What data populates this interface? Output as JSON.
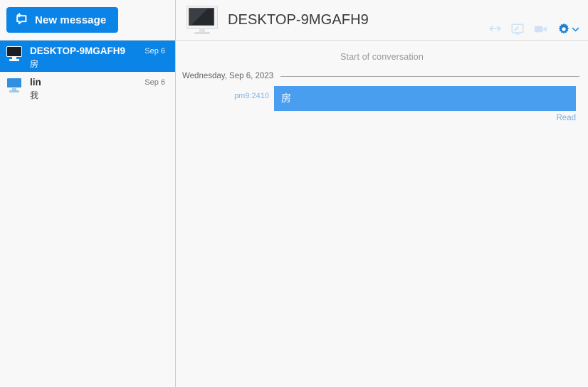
{
  "sidebar": {
    "new_message_button": {
      "label": "New message",
      "icon": "new-message-bubble-icon"
    },
    "conversations": [
      {
        "name": "DESKTOP-9MGAFH9",
        "preview": "房",
        "date": "Sep 6",
        "avatar_icon": "monitor-dark-icon",
        "selected": true
      },
      {
        "name": "lin",
        "preview": "我",
        "date": "Sep 6",
        "avatar_icon": "monitor-blue-icon",
        "selected": false
      }
    ]
  },
  "header": {
    "title": "DESKTOP-9MGAFH9",
    "avatar_icon": "monitor-icon",
    "actions": [
      {
        "name": "transfer-files-icon",
        "icon": "left-right-arrow-icon"
      },
      {
        "name": "remote-desktop-icon",
        "icon": "monitor-pen-icon"
      },
      {
        "name": "video-call-icon",
        "icon": "video-camera-icon"
      },
      {
        "name": "settings-gear-icon",
        "icon": "gear-icon"
      }
    ]
  },
  "conversation": {
    "start_label": "Start of conversation",
    "date_separator": "Wednesday, Sep 6, 2023",
    "messages": [
      {
        "time": "pm9:2410",
        "text": "房",
        "status": "Read",
        "outgoing": true
      }
    ]
  },
  "colors": {
    "accent": "#0b84e8",
    "bubble": "#4a9ef0",
    "background": "#f8f8f8",
    "border": "#d8d8d8"
  }
}
